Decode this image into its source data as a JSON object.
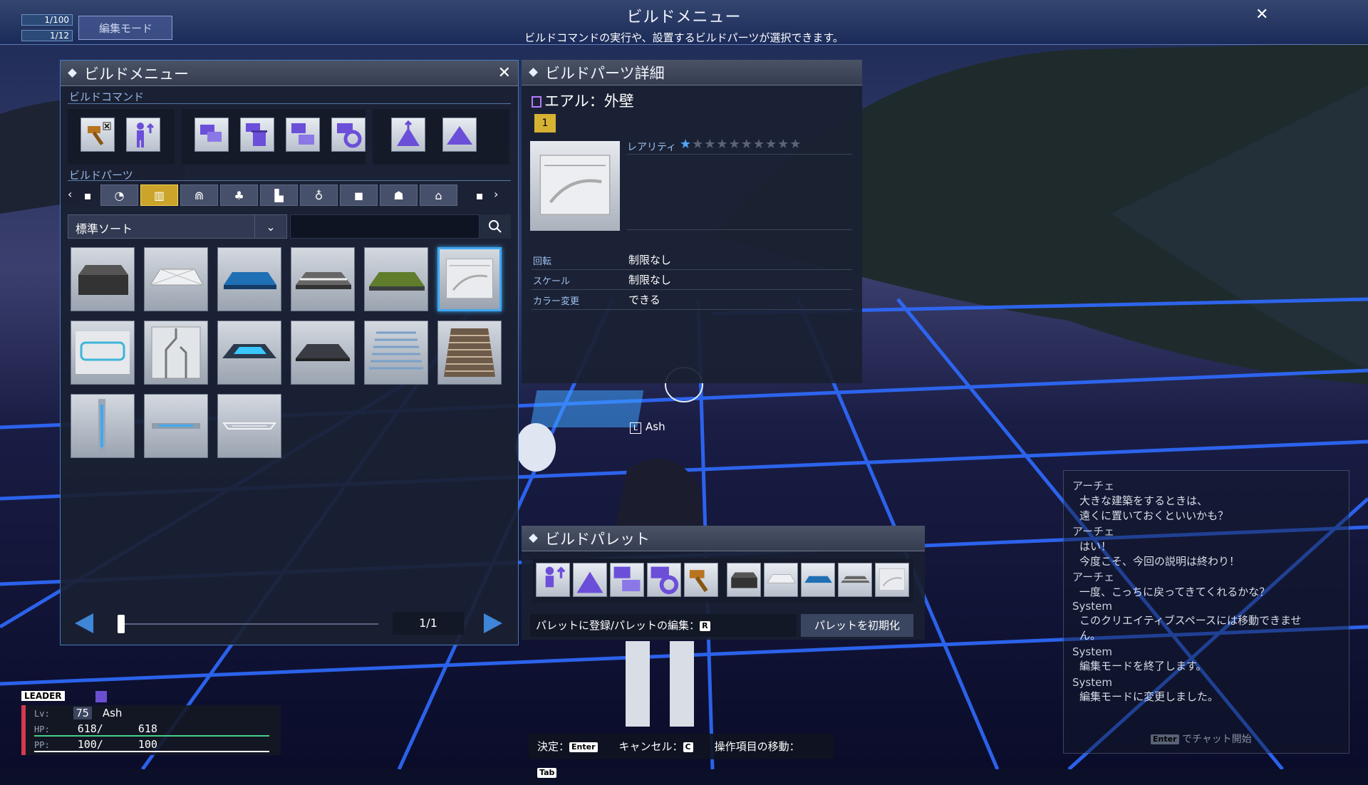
{
  "topbar": {
    "title": "ビルドメニュー",
    "subtitle": "ビルドコマンドの実行や、設置するビルドパーツが選択できます。",
    "close_icon": "close-icon",
    "mini_stats": [
      "1/100",
      "1/12"
    ],
    "mode_label": "編集モード"
  },
  "build_menu": {
    "title": "ビルドメニュー",
    "commands_label": "ビルドコマンド",
    "parts_label": "ビルドパーツ",
    "command_icons": [
      [
        "hammer-remove-icon",
        "character-move-icon"
      ],
      [
        "copy-parts-icon",
        "delete-parts-icon",
        "group-parts-icon",
        "settings-parts-icon"
      ],
      [
        "terrain-raise-icon",
        "terrain-flatten-icon"
      ]
    ],
    "categories": [
      "all-icon",
      "recent-icon",
      "wall-icon",
      "arch-icon",
      "tree-icon",
      "chair-icon",
      "trophy-icon",
      "blocks-icon",
      "figures-icon",
      "house-icon",
      "misc-icon"
    ],
    "active_category_index": 2,
    "sort_label": "標準ソート",
    "search_placeholder": "",
    "parts": [
      "dark-box-part",
      "white-sheet-part",
      "blue-floor-part",
      "striped-floor-part",
      "grass-floor-part",
      "curved-wall-part",
      "frame-panel-part",
      "circuit-wall-part",
      "blue-pad-part",
      "dark-plate-part",
      "wave-floor-part",
      "wood-slat-part",
      "pillar-part",
      "bar-part",
      "rail-part"
    ],
    "selected_part_index": 5,
    "page": "1/1",
    "slider_value": 0
  },
  "detail": {
    "title": "ビルドパーツ詳細",
    "item_name": "エアル：外壁",
    "rank": "1",
    "rarity_label": "レアリティ",
    "rarity_value": 1,
    "rarity_max": 10,
    "properties": [
      {
        "key": "回転",
        "value": "制限なし"
      },
      {
        "key": "スケール",
        "value": "制限なし"
      },
      {
        "key": "カラー変更",
        "value": "できる"
      }
    ]
  },
  "palette": {
    "title": "ビルドパレット",
    "register_label": "パレットに登録/パレットの編集：",
    "register_key": "R",
    "reset_label": "パレットを初期化",
    "slots": [
      "character-move-icon",
      "terrain-raise-icon",
      "group-parts-icon",
      "settings-parts-icon",
      "hammer-remove-icon",
      "dark-box-part",
      "white-sheet-part",
      "blue-floor-part",
      "striped-floor-part",
      "curved-wall-part"
    ]
  },
  "world": {
    "player_tag": "Ash"
  },
  "chat": {
    "entries": [
      {
        "name": "アーチェ",
        "lines": [
          "大きな建築をするときは、",
          "遠くに置いておくといいかも？"
        ]
      },
      {
        "name": "アーチェ",
        "lines": [
          "はい！",
          "今度こそ、今回の説明は終わり！"
        ]
      },
      {
        "name": "アーチェ",
        "lines": [
          "一度、こっちに戻ってきてくれるかな？"
        ]
      },
      {
        "name": "System",
        "lines": [
          "このクリエイティブスペースには移動できませ",
          "ん。"
        ]
      },
      {
        "name": "System",
        "lines": [
          "編集モードを終了します。"
        ]
      },
      {
        "name": "System",
        "lines": [
          "編集モードに変更しました。"
        ]
      }
    ],
    "input_key": "Enter",
    "input_hint": "でチャット開始"
  },
  "player": {
    "leader_tag": "LEADER",
    "level_label": "Lv:",
    "level": "75",
    "name": "Ash",
    "hp_label": "HP:",
    "hp": "618/",
    "hp_max": "618",
    "pp_label": "PP:",
    "pp": "100/",
    "pp_max": "100"
  },
  "keyguide": [
    {
      "label": "決定：",
      "key": "Enter"
    },
    {
      "label": "キャンセル：",
      "key": "C"
    },
    {
      "label": "操作項目の移動：",
      "key": "Tab"
    }
  ],
  "colors": {
    "grid": "#2f6bff",
    "accent": "#3fa8f0",
    "active_tab": "#caa52a",
    "hp_bar": "#46d08a"
  }
}
